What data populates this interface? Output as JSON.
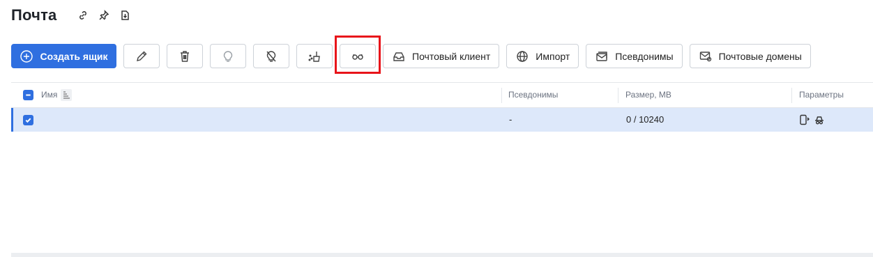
{
  "page": {
    "title": "Почта"
  },
  "title_icons": [
    "link-icon",
    "pin-icon",
    "export-icon"
  ],
  "toolbar": {
    "create_label": "Создать ящик",
    "mail_client_label": "Почтовый клиент",
    "import_label": "Импорт",
    "aliases_label": "Псевдонимы",
    "domains_label": "Почтовые домены",
    "icons": [
      "plus-circle-icon",
      "pencil-icon",
      "trash-icon",
      "bulb-icon",
      "bulb-off-icon",
      "clean-icon",
      "glasses-icon",
      "inbox-icon",
      "globe-import-icon",
      "envelope-stack-icon",
      "envelope-at-icon"
    ],
    "highlighted": "glasses-icon"
  },
  "table": {
    "columns": [
      "Имя",
      "Псевдонимы",
      "Размер, MB",
      "Параметры"
    ],
    "rows": [
      {
        "name": "",
        "aliases": "-",
        "size": "0 / 10240",
        "params": [
          "phone-forward-icon",
          "incognito-icon"
        ],
        "selected": true
      }
    ]
  },
  "colors": {
    "accent": "#2f6fe0",
    "highlight_box": "#e8141a",
    "selected_row": "#dde8fa"
  }
}
